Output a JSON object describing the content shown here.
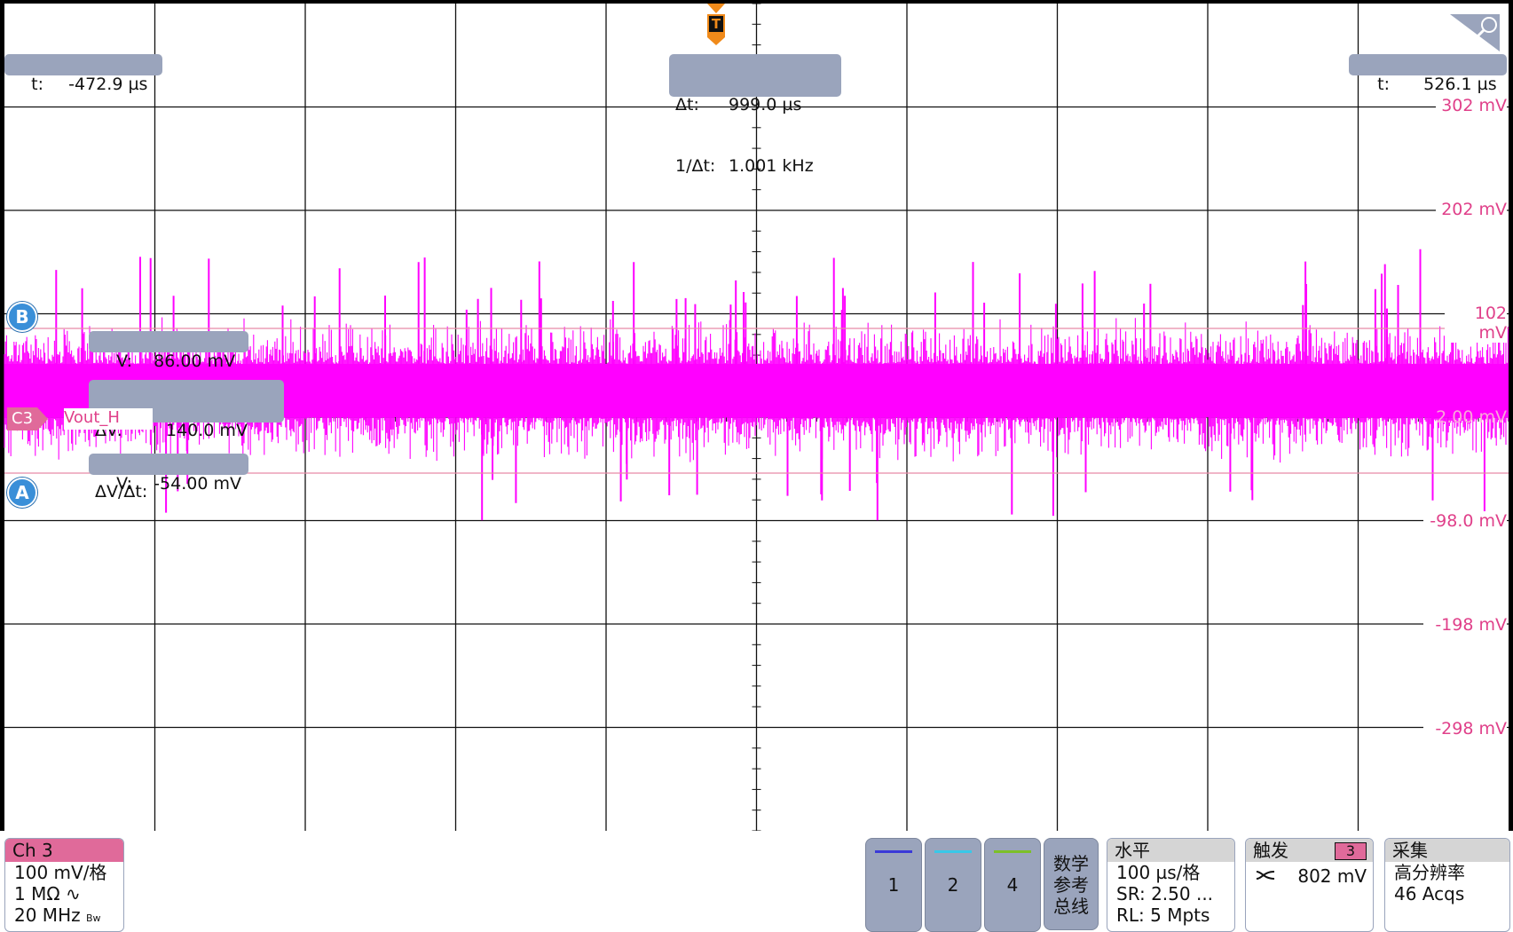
{
  "cursors": {
    "t_a": "-472.9 µs",
    "t_b": "526.1 µs",
    "delta_t_label": "Δt:",
    "delta_t": "999.0 µs",
    "inv_delta_t_label": "1/Δt:",
    "inv_delta_t": "1.001 kHz",
    "t_label": "t:",
    "v_label": "V:",
    "v_b": "86.00 mV",
    "v_a": "-54.00 mV",
    "delta_v_label": "ΔV:",
    "delta_v": "140.0 mV",
    "dv_dt_label": "ΔV/Δt:"
  },
  "markers": {
    "trigger": "T",
    "cursor_a": "A",
    "cursor_b": "B",
    "channel": "C3",
    "trace_name": "Vout_H"
  },
  "axis": {
    "labels": [
      "302 mV",
      "202 mV",
      "102 mV",
      "2.00 mV",
      "-98.0 mV",
      "-198 mV",
      "-298 mV"
    ],
    "label_color": "#e0408a"
  },
  "trace": {
    "color": "#ff00ff"
  },
  "channel_card": {
    "title": "Ch 3",
    "scale": "100 mV/格",
    "impedance": "1 MΩ ∿",
    "bandwidth": "20 MHz",
    "bw_badge": "Bw",
    "header_color": "#e06a9a"
  },
  "channel_buttons": [
    {
      "label": "1",
      "color": "#3a3ad8"
    },
    {
      "label": "2",
      "color": "#38c8e8"
    },
    {
      "label": "4",
      "color": "#7cc028"
    }
  ],
  "math_ref_bus": [
    "数学",
    "参考",
    "总线"
  ],
  "horizontal": {
    "title": "水平",
    "scale": "100 µs/格",
    "sample_rate": "SR: 2.50 ...",
    "record_length": "RL: 5 Mpts"
  },
  "trigger_card": {
    "title": "触发",
    "source": "3",
    "slope_icon": "edge-slope-icon",
    "level": "802 mV"
  },
  "acquisition": {
    "title": "采集",
    "mode": "高分辨率",
    "count": "46 Acqs"
  }
}
